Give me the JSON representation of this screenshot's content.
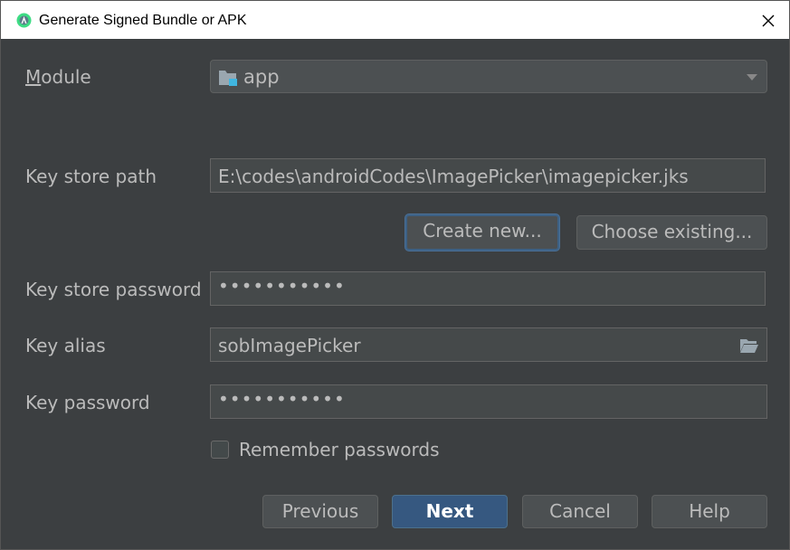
{
  "window": {
    "title": "Generate Signed Bundle or APK"
  },
  "module": {
    "label": "Module",
    "value": "app"
  },
  "keystore_path": {
    "label": "Key store path",
    "value": "E:\\codes\\androidCodes\\ImagePicker\\imagepicker.jks"
  },
  "buttons": {
    "create_new": "Create new...",
    "choose_existing": "Choose existing..."
  },
  "keystore_password": {
    "label": "Key store password",
    "value": "•••••••••••"
  },
  "key_alias": {
    "label": "Key alias",
    "value": "sobImagePicker"
  },
  "key_password": {
    "label": "Key password",
    "value": "•••••••••••"
  },
  "remember": {
    "label": "Remember passwords",
    "checked": false
  },
  "footer": {
    "previous": "Previous",
    "next": "Next",
    "cancel": "Cancel",
    "help": "Help"
  },
  "colors": {
    "background": "#3c3f41",
    "accent": "#365880",
    "field": "#45494a",
    "text": "#bbbbbb"
  },
  "icons": {
    "app": "android-studio-icon",
    "close": "close-icon",
    "module": "module-folder-icon",
    "dropdown": "chevron-down-icon",
    "browse": "folder-open-icon"
  }
}
